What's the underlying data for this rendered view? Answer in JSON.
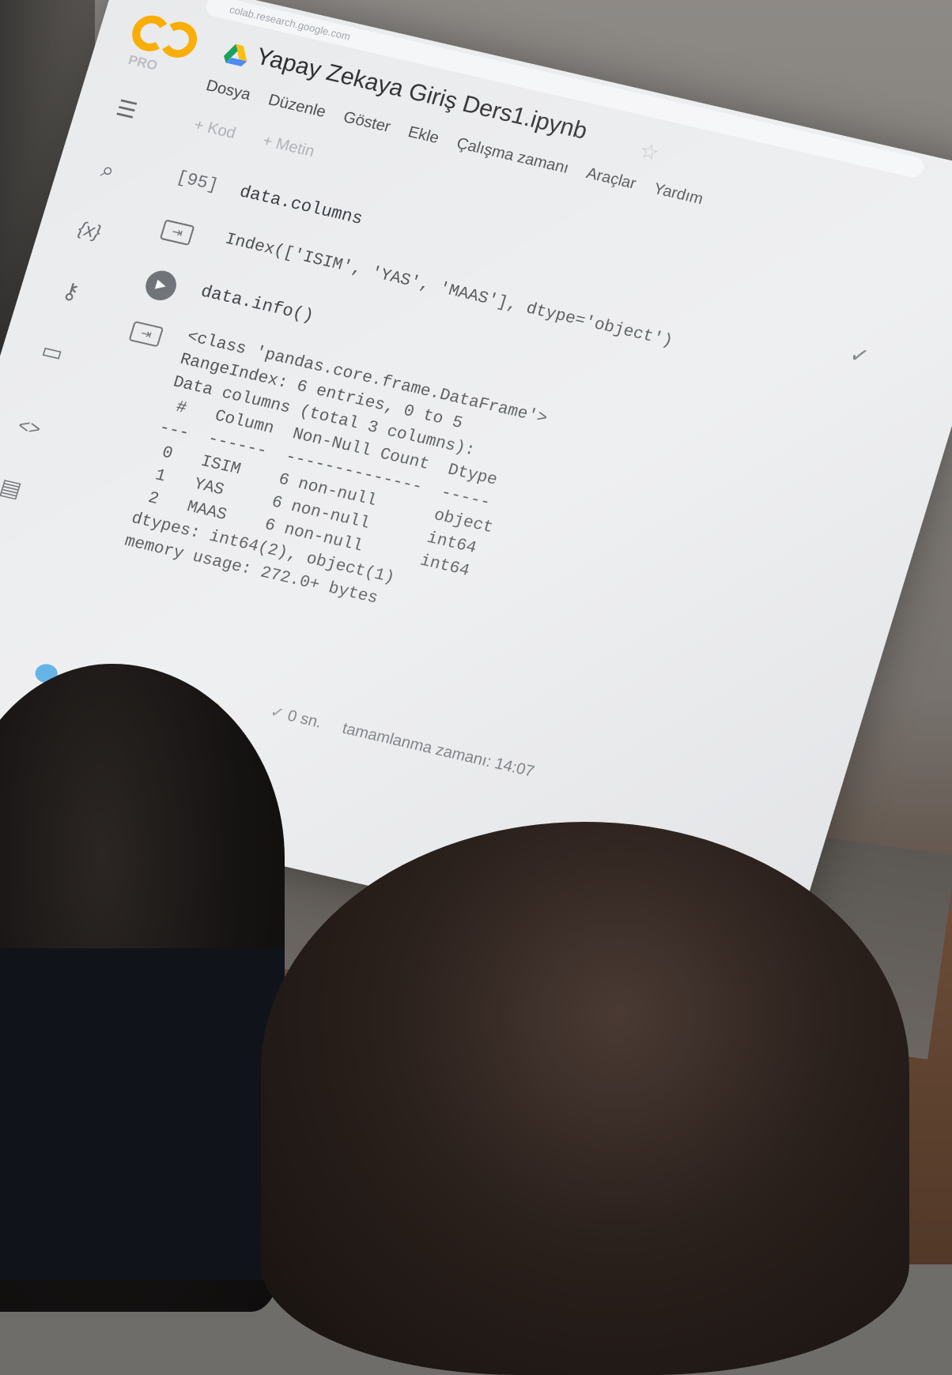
{
  "browser": {
    "url": "colab.research.google.com"
  },
  "colab": {
    "pro_label": "PRO",
    "doc_title": "Yapay Zekaya Giriş Ders1.ipynb",
    "menu": [
      "Dosya",
      "Düzenle",
      "Göster",
      "Ekle",
      "Çalışma zamanı",
      "Araçlar",
      "Yardım"
    ],
    "toolbar": {
      "add_code": "+ Kod",
      "add_text": "+ Metin"
    }
  },
  "cells": [
    {
      "exec_count": "[95]",
      "code": "data.columns",
      "output": "Index(['ISIM', 'YAS', 'MAAS'], dtype='object')"
    },
    {
      "code": "data.info()",
      "output": "<class 'pandas.core.frame.DataFrame'>\nRangeIndex: 6 entries, 0 to 5\nData columns (total 3 columns):\n #   Column  Non-Null Count  Dtype \n---  ------  --------------  ----- \n 0   ISIM    6 non-null      object\n 1   YAS     6 non-null      int64 \n 2   MAAS    6 non-null      int64 \ndtypes: int64(2), object(1)\nmemory usage: 272.0+ bytes"
    }
  ],
  "status": {
    "duration": "0 sn.",
    "completed": "tamamlanma zamanı: 14:07"
  },
  "icons": {
    "sidebar": [
      "toc-icon",
      "search-icon",
      "variables-icon",
      "key-icon",
      "folder-icon",
      "code-icon",
      "notes-icon",
      "terminal-icon"
    ]
  }
}
